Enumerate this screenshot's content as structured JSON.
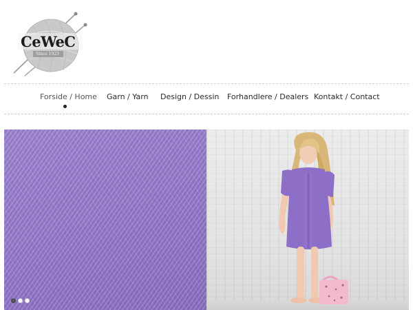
{
  "logo": {
    "text_main": "CeWeC",
    "since": "Since 1923"
  },
  "nav": {
    "items": [
      {
        "label": "Forside / Home",
        "active": true
      },
      {
        "label": "Garn / Yarn",
        "active": false
      },
      {
        "label": "Design / Dessin",
        "active": false
      },
      {
        "label": "Forhandlere / Dealers",
        "active": false
      },
      {
        "label": "Kontakt / Contact",
        "active": false
      }
    ]
  },
  "slider": {
    "slide_count": 3,
    "current_slide": 1
  },
  "colors": {
    "yarn_purple": "#9b80cf",
    "dress_purple": "#8e6fc8",
    "nav_text": "#2a2a2a"
  },
  "icons": {
    "logo_yarn": "yarn-ball-icon"
  }
}
